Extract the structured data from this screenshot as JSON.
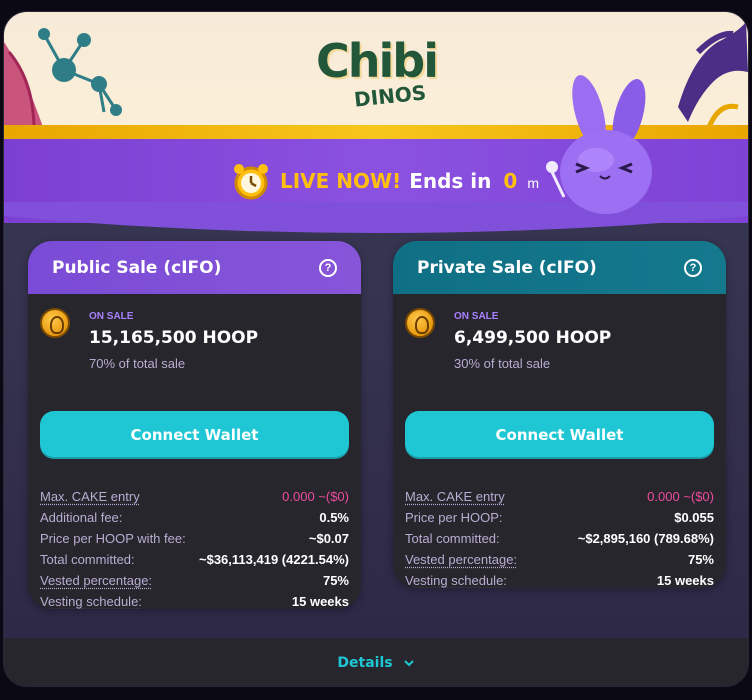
{
  "banner": {
    "logo_main": "Chibi",
    "logo_sub": "DINOS"
  },
  "live": {
    "label": "LIVE NOW!",
    "ends_in": "Ends in",
    "value": "0",
    "unit": "m"
  },
  "public_sale": {
    "title": "Public Sale (cIFO)",
    "on_sale_label": "ON SALE",
    "amount": "15,165,500 HOOP",
    "percent_text": "70% of total sale",
    "connect_label": "Connect Wallet",
    "rows": [
      {
        "label": "Max. CAKE entry",
        "value": "0.000 ~($0)"
      },
      {
        "label": "Additional fee:",
        "value": "0.5%"
      },
      {
        "label": "Price per HOOP with fee:",
        "value": "~$0.07"
      },
      {
        "label": "Total committed:",
        "value": "~$36,113,419 (4221.54%)"
      },
      {
        "label": "Vested percentage:",
        "value": "75%"
      },
      {
        "label": "Vesting schedule:",
        "value": "15 weeks"
      }
    ]
  },
  "private_sale": {
    "title": "Private Sale (cIFO)",
    "on_sale_label": "ON SALE",
    "amount": "6,499,500 HOOP",
    "percent_text": "30% of total sale",
    "connect_label": "Connect Wallet",
    "rows": [
      {
        "label": "Max. CAKE entry",
        "value": "0.000 ~($0)"
      },
      {
        "label": "Price per HOOP:",
        "value": "$0.055"
      },
      {
        "label": "Total committed:",
        "value": "~$2,895,160 (789.68%)"
      },
      {
        "label": "Vested percentage:",
        "value": "75%"
      },
      {
        "label": "Vesting schedule:",
        "value": "15 weeks"
      }
    ]
  },
  "footer": {
    "details_label": "Details"
  },
  "colors": {
    "accent_cyan": "#1fc7d4",
    "live_gold": "#ffbf0f",
    "pink_value": "#ed4b9e"
  }
}
